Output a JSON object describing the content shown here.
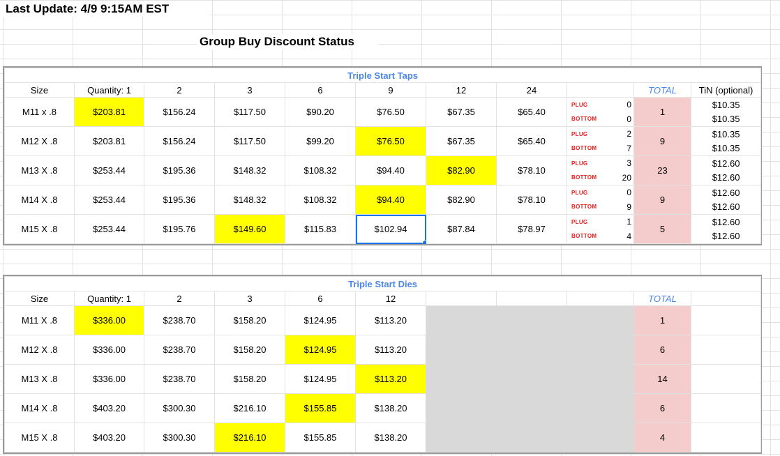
{
  "header": {
    "last_update": "Last Update: 4/9 9:15AM EST",
    "page_title": "Group Buy Discount Status"
  },
  "colors": {
    "highlight": "#ffff00",
    "total_fill": "#f4cccc",
    "section_title": "#4a86e8",
    "plug_bottom_label": "#ea1c1c",
    "disabled_fill": "#d9d9d9",
    "selection": "#1a73e8"
  },
  "taps": {
    "title": "Triple Start Taps",
    "headers": [
      "Size",
      "Quantity: 1",
      "2",
      "3",
      "6",
      "9",
      "12",
      "24"
    ],
    "total_label": "TOTAL",
    "tin_label": "TiN (optional)",
    "plug_label": "PLUG",
    "bottom_label": "BOTTOM",
    "rows": [
      {
        "size": "M11 x .8",
        "prices": [
          "$203.81",
          "$156.24",
          "$117.50",
          "$90.20",
          "$76.50",
          "$67.35",
          "$65.40"
        ],
        "plug": "0",
        "bottom": "0",
        "total": "1",
        "tin_plug": "$10.35",
        "tin_bottom": "$10.35",
        "highlight_col": 0
      },
      {
        "size": "M12 X .8",
        "prices": [
          "$203.81",
          "$156.24",
          "$117.50",
          "$99.20",
          "$76.50",
          "$67.35",
          "$65.40"
        ],
        "plug": "2",
        "bottom": "7",
        "total": "9",
        "tin_plug": "$10.35",
        "tin_bottom": "$10.35",
        "highlight_col": 4
      },
      {
        "size": "M13 X .8",
        "prices": [
          "$253.44",
          "$195.36",
          "$148.32",
          "$108.32",
          "$94.40",
          "$82.90",
          "$78.10"
        ],
        "plug": "3",
        "bottom": "20",
        "total": "23",
        "tin_plug": "$12.60",
        "tin_bottom": "$12.60",
        "highlight_col": 5
      },
      {
        "size": "M14 X .8",
        "prices": [
          "$253.44",
          "$195.36",
          "$148.32",
          "$108.32",
          "$94.40",
          "$82.90",
          "$78.10"
        ],
        "plug": "0",
        "bottom": "9",
        "total": "9",
        "tin_plug": "$12.60",
        "tin_bottom": "$12.60",
        "highlight_col": 4
      },
      {
        "size": "M15 X .8",
        "prices": [
          "$253.44",
          "$195.76",
          "$149.60",
          "$115.83",
          "$102.94",
          "$87.84",
          "$78.97"
        ],
        "plug": "1",
        "bottom": "4",
        "total": "5",
        "tin_plug": "$12.60",
        "tin_bottom": "$12.60",
        "highlight_col": 2,
        "selected_col": 4
      }
    ]
  },
  "dies": {
    "title": "Triple Start Dies",
    "headers": [
      "Size",
      "Quantity: 1",
      "2",
      "3",
      "6",
      "12"
    ],
    "total_label": "TOTAL",
    "rows": [
      {
        "size": "M11 X .8",
        "prices": [
          "$336.00",
          "$238.70",
          "$158.20",
          "$124.95",
          "$113.20"
        ],
        "total": "1",
        "highlight_col": 0
      },
      {
        "size": "M12 X .8",
        "prices": [
          "$336.00",
          "$238.70",
          "$158.20",
          "$124.95",
          "$113.20"
        ],
        "total": "6",
        "highlight_col": 3
      },
      {
        "size": "M13 X .8",
        "prices": [
          "$336.00",
          "$238.70",
          "$158.20",
          "$124.95",
          "$113.20"
        ],
        "total": "14",
        "highlight_col": 4
      },
      {
        "size": "M14 X .8",
        "prices": [
          "$403.20",
          "$300.30",
          "$216.10",
          "$155.85",
          "$138.20"
        ],
        "total": "6",
        "highlight_col": 3
      },
      {
        "size": "M15 X .8",
        "prices": [
          "$403.20",
          "$300.30",
          "$216.10",
          "$155.85",
          "$138.20"
        ],
        "total": "4",
        "highlight_col": 2
      }
    ]
  }
}
